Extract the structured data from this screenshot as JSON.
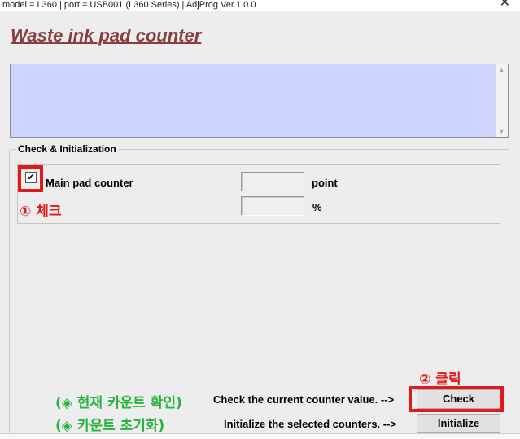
{
  "window": {
    "title": "model = L360 | port = USB001 (L360 Series) | AdjProg Ver.1.0.0",
    "close_glyph": "✕"
  },
  "heading": "Waste ink pad counter",
  "group": {
    "legend": "Check & Initialization",
    "main_pad": {
      "label": "Main pad counter",
      "checked": true,
      "check_glyph": "✔",
      "point_value": "",
      "point_unit": "point",
      "percent_value": "",
      "percent_unit": "%"
    }
  },
  "annotations": {
    "step1": "① 체크",
    "step2": "② 클릭",
    "check_note": "(◈ 현재 카운트 확인)",
    "init_note": "(◈ 카운트 초기화)"
  },
  "actions": {
    "check_desc": "Check the current counter value. -->",
    "check_button": "Check",
    "init_desc": "Initialize the selected counters. -->",
    "init_button": "Initialize"
  },
  "colors": {
    "heading": "#8b3d3d",
    "listbox": "#ccd4ff",
    "annotation_red": "#e01919",
    "annotation_green": "#27b43c"
  }
}
